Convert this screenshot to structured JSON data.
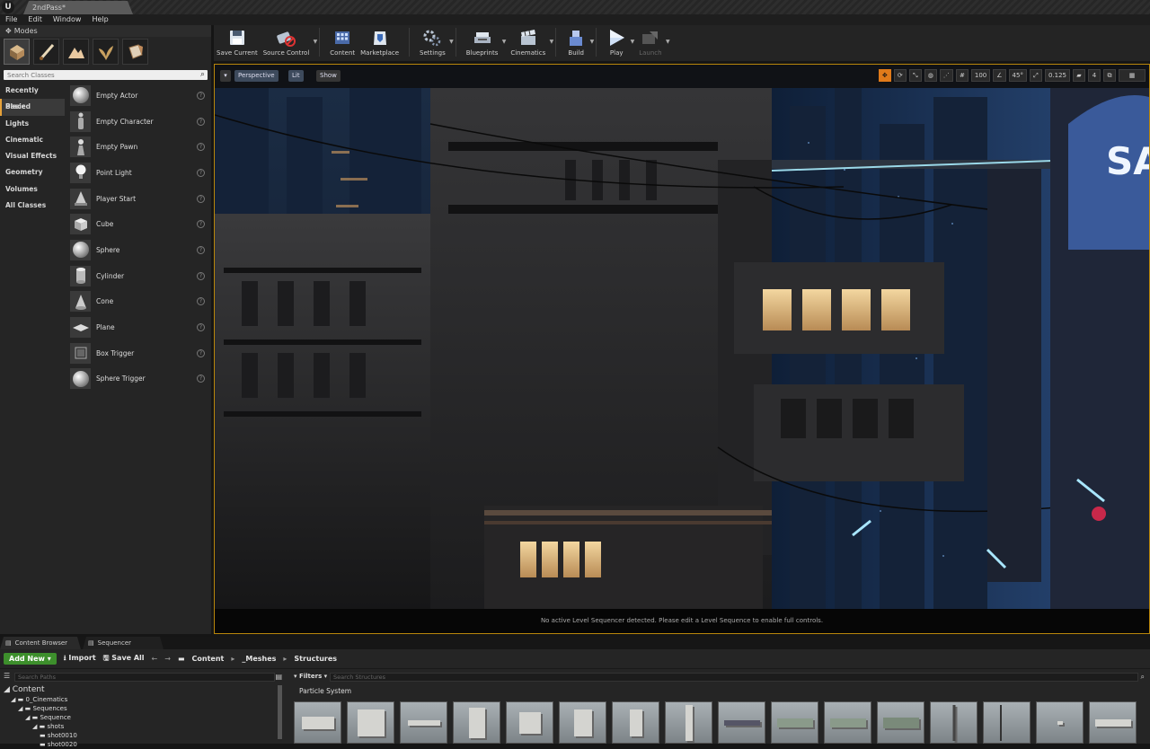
{
  "app": {
    "tab_title": "2ndPass*"
  },
  "menu": [
    "File",
    "Edit",
    "Window",
    "Help"
  ],
  "modes": {
    "title": "Modes",
    "icons": [
      "place-mode-icon",
      "paint-mode-icon",
      "landscape-mode-icon",
      "foliage-mode-icon",
      "geometry-mode-icon"
    ],
    "search_placeholder": "Search Classes",
    "categories": [
      "Recently Placed",
      "Basic",
      "Lights",
      "Cinematic",
      "Visual Effects",
      "Geometry",
      "Volumes",
      "All Classes"
    ],
    "active_category": "Basic",
    "items": [
      "Empty Actor",
      "Empty Character",
      "Empty Pawn",
      "Point Light",
      "Player Start",
      "Cube",
      "Sphere",
      "Cylinder",
      "Cone",
      "Plane",
      "Box Trigger",
      "Sphere Trigger"
    ]
  },
  "toolbar": {
    "save_current": "Save Current",
    "source_control": "Source Control",
    "content": "Content",
    "marketplace": "Marketplace",
    "settings": "Settings",
    "blueprints": "Blueprints",
    "cinematics": "Cinematics",
    "build": "Build",
    "play": "Play",
    "launch": "Launch"
  },
  "viewport": {
    "perspective": "Perspective",
    "lit": "Lit",
    "show": "Show",
    "grid_snap": "100",
    "rotation_snap": "45°",
    "scale_snap": "0.125",
    "camera_speed": "4",
    "status": "No active Level Sequencer detected. Please edit a Level Sequence to enable full controls.",
    "sign_text": "SA"
  },
  "bottom_tabs": [
    "Content Browser",
    "Sequencer"
  ],
  "content_browser": {
    "add_new": "Add New",
    "import": "Import",
    "save_all": "Save All",
    "breadcrumb": [
      "Content",
      "_Meshes",
      "Structures"
    ],
    "search_paths_placeholder": "Search Paths",
    "filters": "Filters",
    "search_placeholder": "Search Structures",
    "filter_label": "Particle System",
    "tree": [
      {
        "label": "Content",
        "depth": 0
      },
      {
        "label": "0_Cinematics",
        "depth": 1
      },
      {
        "label": "Sequences",
        "depth": 2
      },
      {
        "label": "Sequence",
        "depth": 3
      },
      {
        "label": "shots",
        "depth": 4
      },
      {
        "label": "shot0010",
        "depth": 5
      },
      {
        "label": "shot0020",
        "depth": 5
      }
    ],
    "asset_count": 16
  },
  "colors": {
    "accent": "#e6a23a",
    "add_new": "#3d8f2c",
    "viewport_border": "#b8860b"
  }
}
